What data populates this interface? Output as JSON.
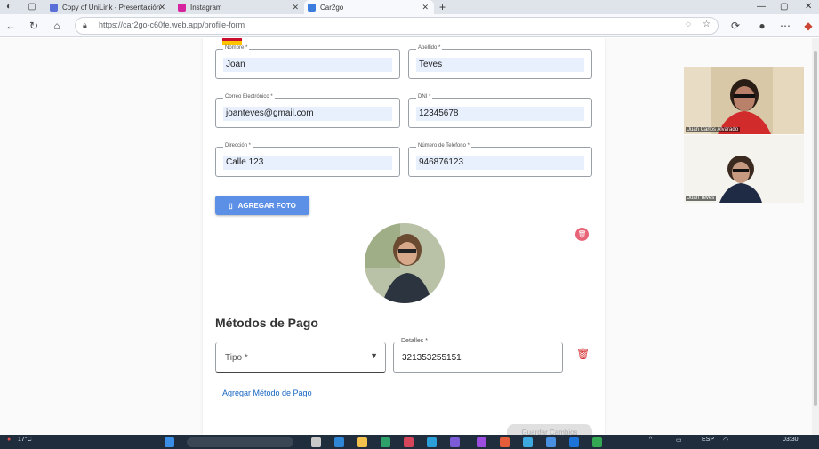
{
  "browser": {
    "tabs": [
      {
        "title": "Copy of UniLink - Presentación",
        "color": "#5a6fd8"
      },
      {
        "title": "Instagram",
        "color": "#d6249f"
      },
      {
        "title": "Car2go",
        "color": "#3b7ddd"
      }
    ],
    "url": "https://car2go-c60fe.web.app/profile-form",
    "new_tab": "+"
  },
  "form": {
    "fields": [
      {
        "label": "Nombre *",
        "value": "Joan"
      },
      {
        "label": "Apellido *",
        "value": "Teves"
      },
      {
        "label": "Correo Electrónico *",
        "value": "joanteves@gmail.com"
      },
      {
        "label": "DNI *",
        "value": "12345678"
      },
      {
        "label": "Dirección *",
        "value": "Calle 123"
      },
      {
        "label": "Número de Teléfono *",
        "value": "946876123"
      }
    ],
    "add_photo_label": "AGREGAR FOTO",
    "payment_title": "Métodos de Pago",
    "tipo_placeholder": "Tipo *",
    "detalles_label": "Detalles *",
    "detalles_value": "321353255151",
    "add_payment_label": "Agregar Método de Pago",
    "save_label": "Guardar Cambios"
  },
  "meet": {
    "participants": [
      "Juan Carlos Alvarado",
      "Joan Teves"
    ]
  },
  "taskbar": {
    "weather": "17°C",
    "language": "ESP",
    "time": "03:30"
  }
}
